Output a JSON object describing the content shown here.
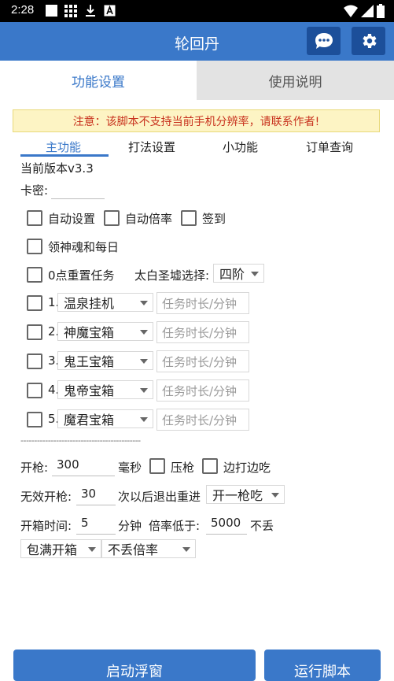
{
  "status_bar": {
    "time": "2:28"
  },
  "header": {
    "title": "轮回丹"
  },
  "tabs": {
    "settings": "功能设置",
    "usage": "使用说明"
  },
  "notice": "注意：该脚本不支持当前手机分辨率，请联系作者!",
  "subtabs": [
    "主功能",
    "打法设置",
    "小功能",
    "订单查询"
  ],
  "version": "当前版本v3.3",
  "card_key": {
    "label": "卡密:",
    "value": ""
  },
  "checkboxes": {
    "auto_setting": "自动设置",
    "auto_multiplier": "自动倍率",
    "checkin": "签到",
    "soul_daily": "领神魂和每日",
    "reset_midnight": "0点重置任务"
  },
  "taibai": {
    "label": "太白圣墟选择:",
    "selected": "四阶"
  },
  "tasks": [
    {
      "index": "1.",
      "name": "温泉挂机",
      "placeholder": "任务时长/分钟"
    },
    {
      "index": "2.",
      "name": "神魔宝箱",
      "placeholder": "任务时长/分钟"
    },
    {
      "index": "3.",
      "name": "鬼王宝箱",
      "placeholder": "任务时长/分钟"
    },
    {
      "index": "4.",
      "name": "鬼帝宝箱",
      "placeholder": "任务时长/分钟"
    },
    {
      "index": "5.",
      "name": "魔君宝箱",
      "placeholder": "任务时长/分钟"
    }
  ],
  "divider_text": "--------------------------------------------",
  "fire": {
    "label": "开枪:",
    "value": "300",
    "unit": "毫秒",
    "press": "压枪",
    "strafe": "边打边吃"
  },
  "invalid": {
    "label": "无效开枪:",
    "value": "30",
    "suffix": "次以后退出重进",
    "selected": "开一枪吃"
  },
  "chest": {
    "label": "开箱时间:",
    "value": "5",
    "unit": "分钟",
    "rate_label": "倍率低于:",
    "rate_value": "5000",
    "rate_suffix": "不丢"
  },
  "chest_mode": {
    "selected": "包满开箱",
    "drop_selected": "不丢倍率"
  },
  "buttons": {
    "start_float": "启动浮窗",
    "run_script": "运行脚本"
  },
  "colors": {
    "primary": "#3a78c9",
    "header_button": "#1c4f9a",
    "notice_bg": "#fdf4c4",
    "notice_text": "#c8321e"
  }
}
